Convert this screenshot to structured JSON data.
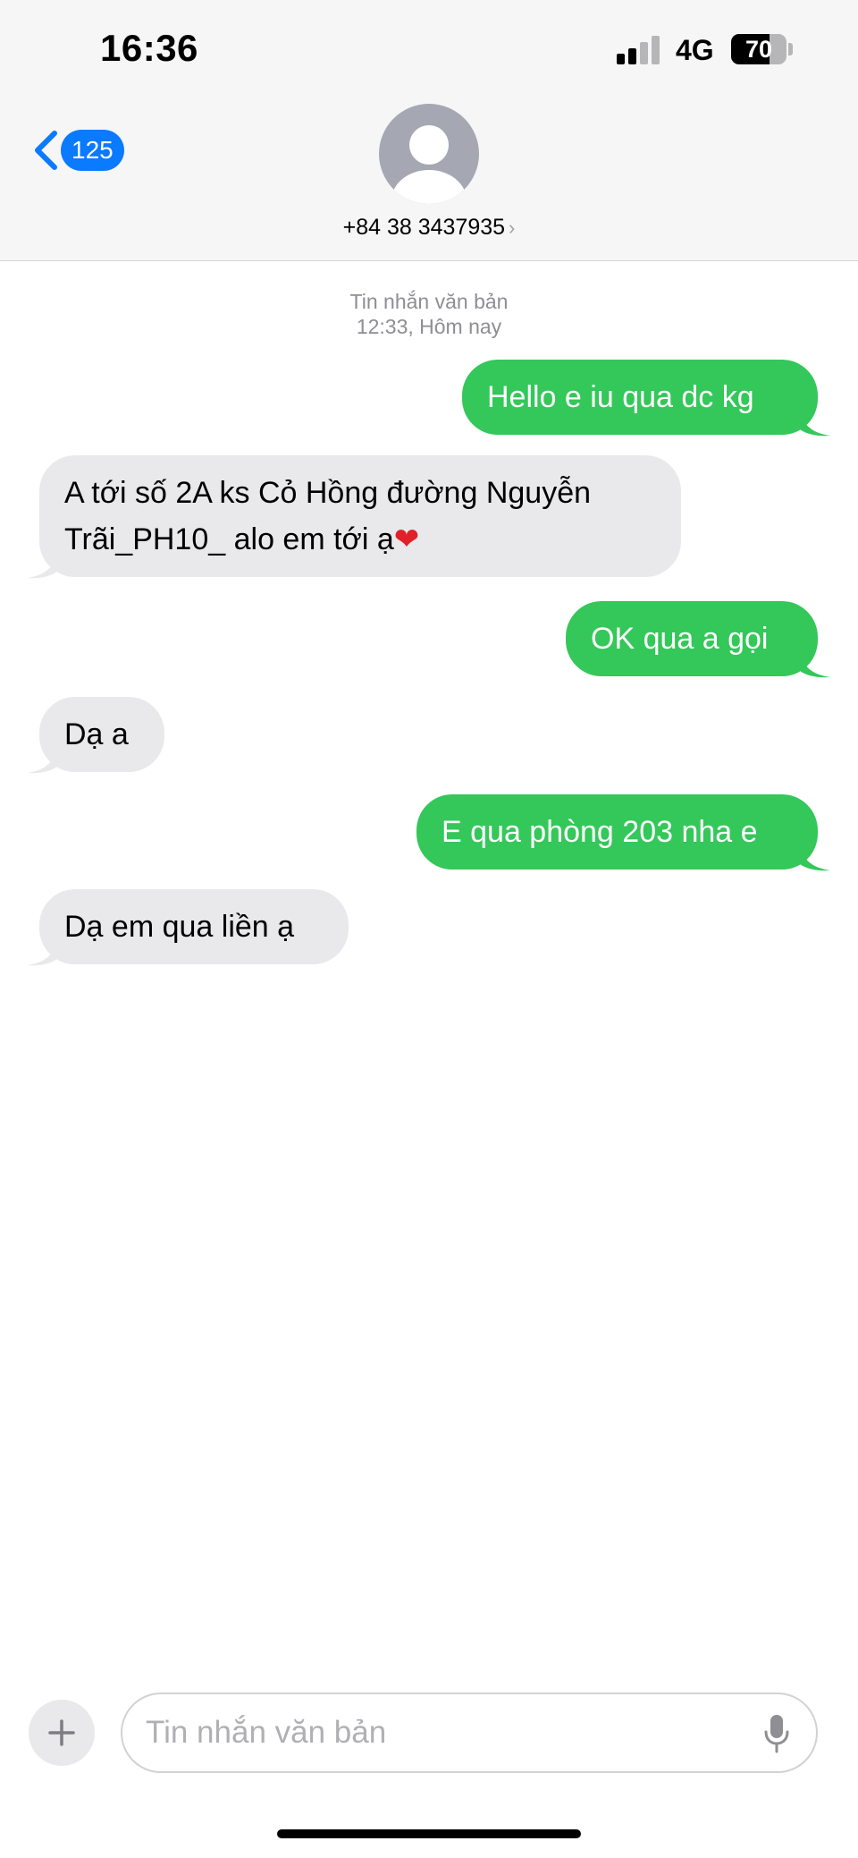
{
  "status_bar": {
    "time": "16:36",
    "network": "4G",
    "battery": "70",
    "battery_level": 0.7,
    "signal_bars_active": 2,
    "signal_bars_total": 4
  },
  "header": {
    "back_count": "125",
    "contact": "+84 38 3437935",
    "contact_chevron": "›"
  },
  "thread": {
    "type_label": "Tin nhắn văn bản",
    "timestamp": "12:33, Hôm nay",
    "messages": [
      {
        "direction": "outgoing",
        "text": "Hello e iu qua dc kg"
      },
      {
        "direction": "incoming",
        "text": "A tới số 2A ks Cỏ Hồng đường Nguyễn",
        "text2": "Trãi_PH10_ alo em tới ạ",
        "emoji": "❤"
      },
      {
        "direction": "outgoing",
        "text": "OK qua a gọi"
      },
      {
        "direction": "incoming",
        "text": "Dạ a"
      },
      {
        "direction": "outgoing",
        "text": "E qua phòng 203 nha e"
      },
      {
        "direction": "incoming",
        "text": "Dạ em qua liền ạ"
      }
    ]
  },
  "composer": {
    "placeholder": "Tin nhắn văn bản"
  },
  "colors": {
    "outgoing_bubble": "#34c759",
    "incoming_bubble": "#e9e9eb",
    "accent": "#0a7aff",
    "heart": "#e0212a"
  },
  "icons": {
    "back": "chevron-left-icon",
    "avatar": "person-icon",
    "plus": "plus-icon",
    "mic": "microphone-icon"
  }
}
